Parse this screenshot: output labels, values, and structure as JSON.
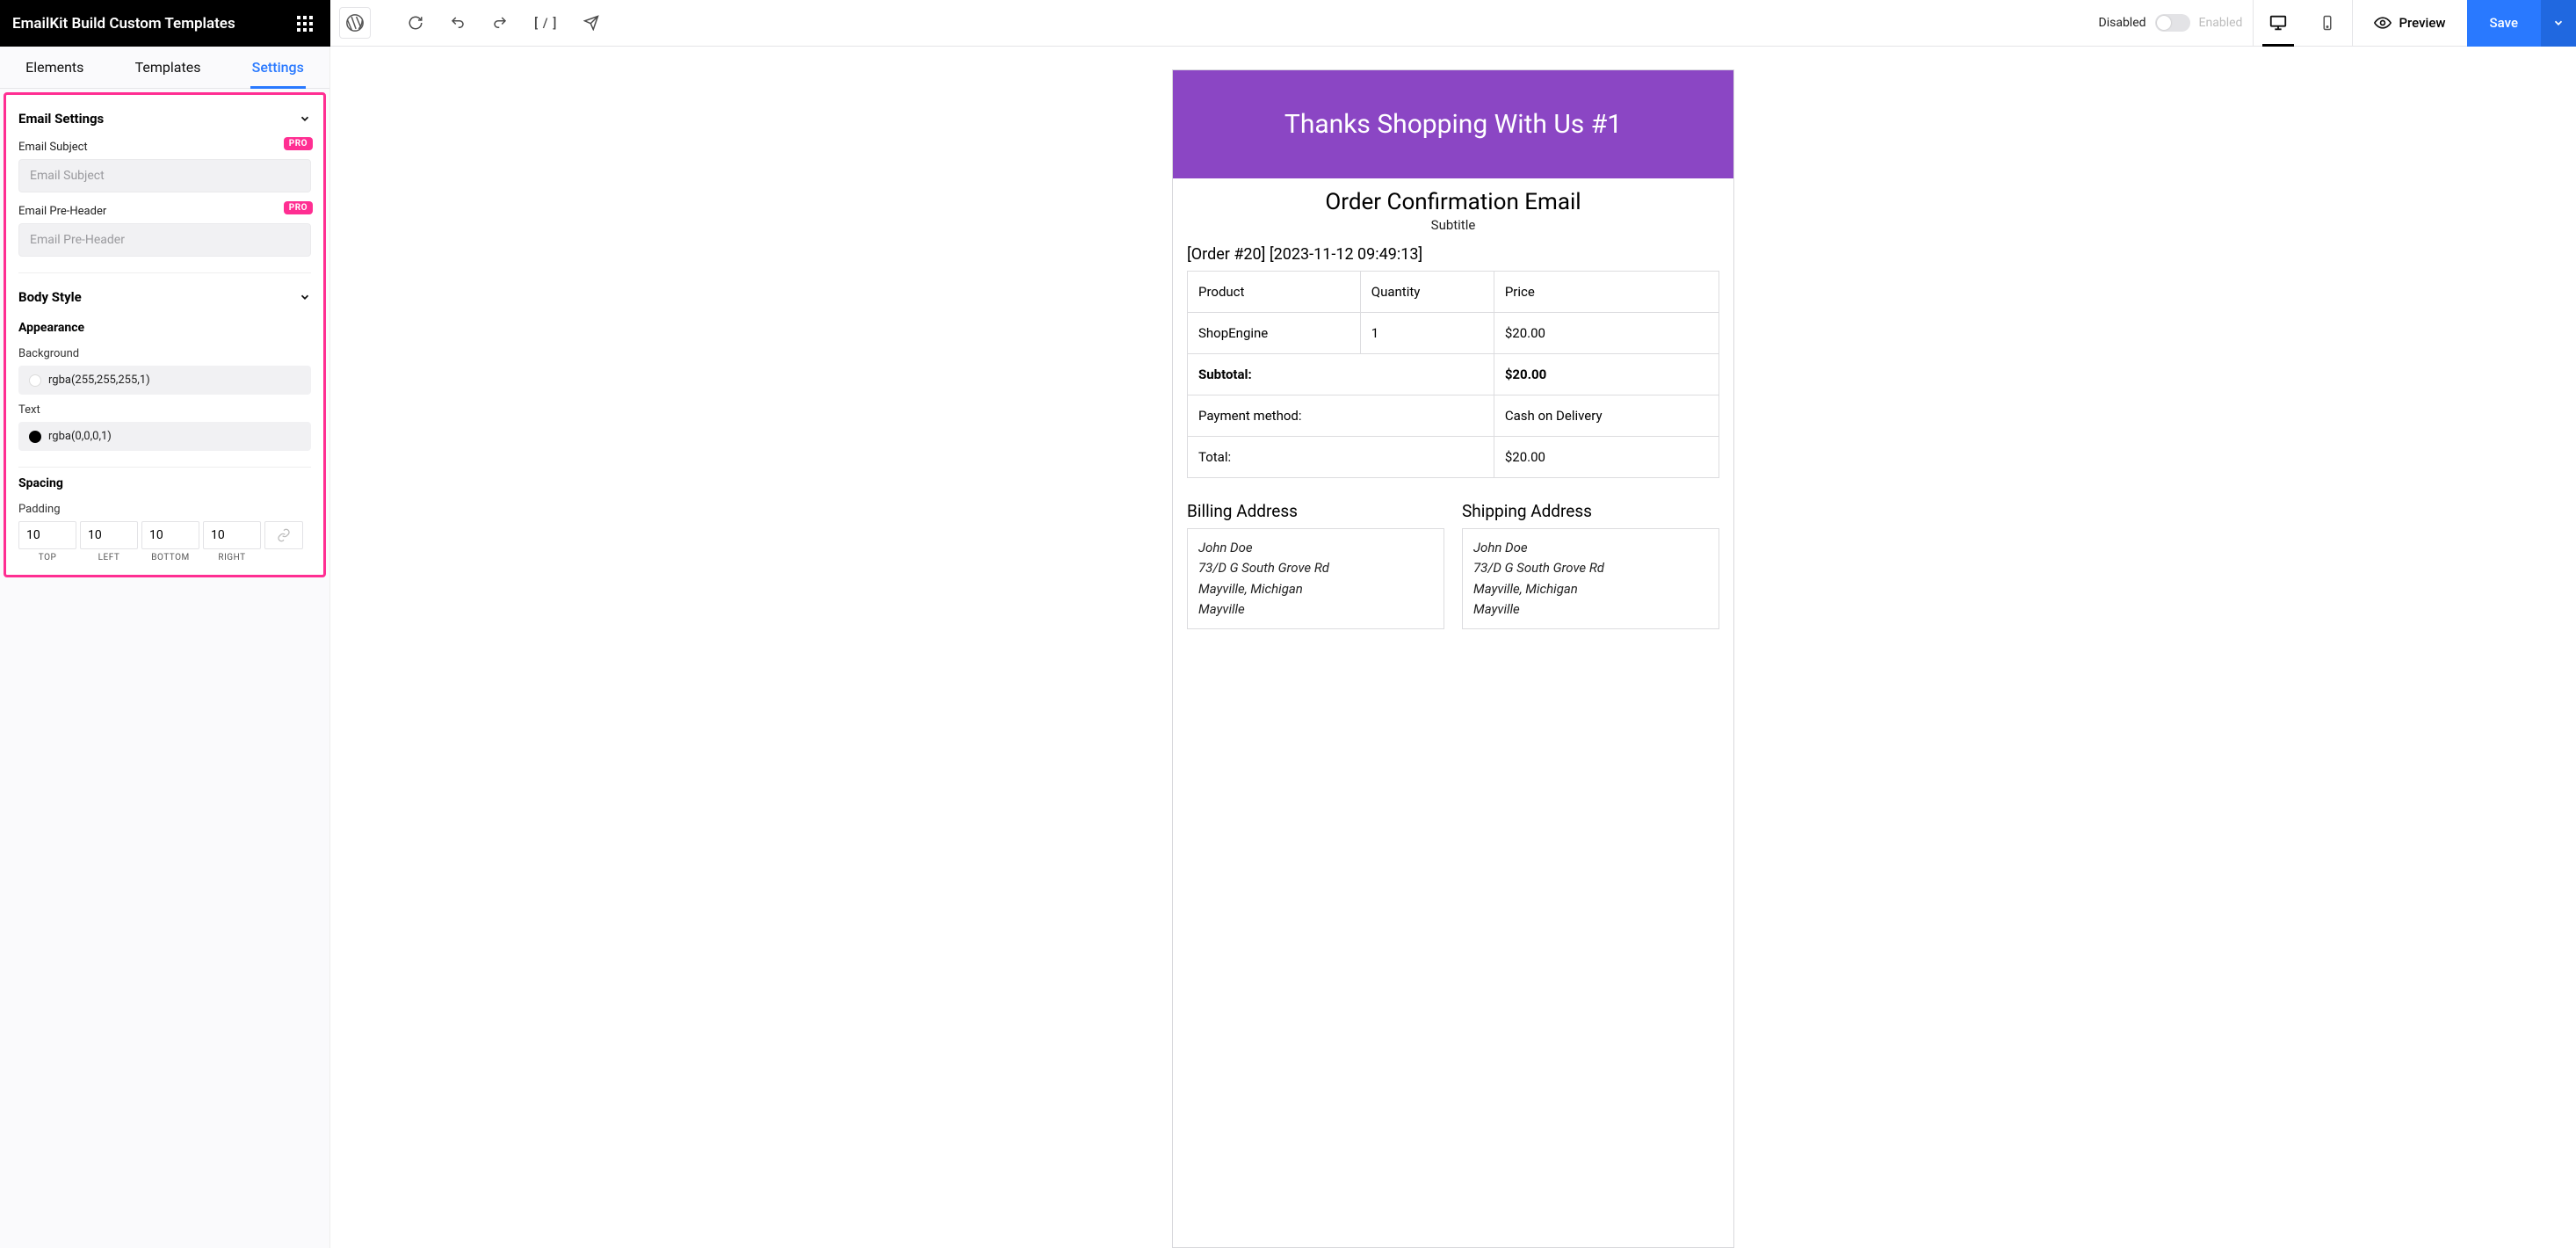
{
  "header": {
    "title": "EmailKit Build Custom Templates"
  },
  "topbar": {
    "disabled_label": "Disabled",
    "enabled_label": "Enabled",
    "preview_label": "Preview",
    "save_label": "Save"
  },
  "tabs": {
    "elements": "Elements",
    "templates": "Templates",
    "settings": "Settings"
  },
  "settings": {
    "email_settings_title": "Email Settings",
    "email_subject_label": "Email Subject",
    "email_subject_placeholder": "Email Subject",
    "email_preheader_label": "Email Pre-Header",
    "email_preheader_placeholder": "Email Pre-Header",
    "pro_badge": "PRO",
    "body_style_title": "Body Style",
    "appearance_title": "Appearance",
    "background_label": "Background",
    "background_value": "rgba(255,255,255,1)",
    "text_label": "Text",
    "text_value": "rgba(0,0,0,1)",
    "spacing_title": "Spacing",
    "padding_label": "Padding",
    "padding": {
      "top": "10",
      "left": "10",
      "bottom": "10",
      "right": "10"
    },
    "padding_labels": {
      "top": "TOP",
      "left": "LEFT",
      "bottom": "BOTTOM",
      "right": "RIGHT"
    }
  },
  "email": {
    "banner": "Thanks Shopping With Us #1",
    "title": "Order Confirmation Email",
    "subtitle": "Subtitle",
    "order_line": "[Order #20] [2023-11-12 09:49:13]",
    "cols": {
      "product": "Product",
      "quantity": "Quantity",
      "price": "Price"
    },
    "row": {
      "product": "ShopEngine",
      "quantity": "1",
      "price": "$20.00"
    },
    "subtotal_label": "Subtotal:",
    "subtotal_value": "$20.00",
    "payment_label": "Payment method:",
    "payment_value": "Cash on Delivery",
    "total_label": "Total:",
    "total_value": "$20.00",
    "billing_h": "Billing Address",
    "shipping_h": "Shipping Address",
    "addr": {
      "name": "John Doe",
      "street": "73/D G South Grove Rd",
      "city": "Mayville, Michigan",
      "town": "Mayville"
    }
  }
}
